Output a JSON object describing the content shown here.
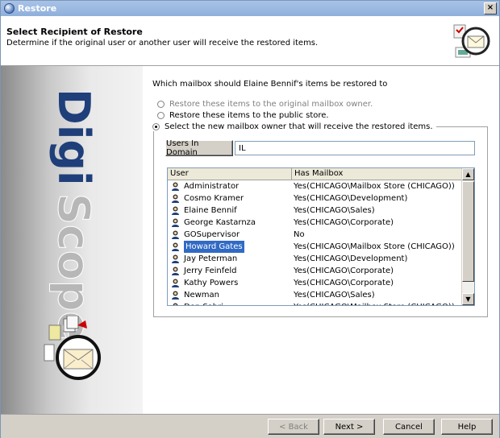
{
  "window": {
    "title": "Restore",
    "close_glyph": "×"
  },
  "header": {
    "title": "Select Recipient of Restore",
    "subtitle": "Determine if the original user or another user will receive the restored items."
  },
  "sidebar": {
    "brand_text": "DigiScope"
  },
  "content": {
    "question": "Which mailbox should Elaine Bennif's items be restored to",
    "options": [
      {
        "label": "Restore these items to the original mailbox owner.",
        "checked": false,
        "enabled": false
      },
      {
        "label": "Restore these items to the public store.",
        "checked": false,
        "enabled": true
      },
      {
        "label": "Select the new mailbox owner that will receive the restored items.",
        "checked": true,
        "enabled": true
      }
    ],
    "users_in_domain_button": "Users In Domain",
    "search_value": "IL",
    "columns": {
      "user": "User",
      "mailbox": "Has Mailbox"
    },
    "users": [
      {
        "name": "Administrator",
        "mailbox": "Yes(CHICAGO\\Mailbox Store (CHICAGO))"
      },
      {
        "name": "Cosmo Kramer",
        "mailbox": "Yes(CHICAGO\\Development)"
      },
      {
        "name": "Elaine Bennif",
        "mailbox": "Yes(CHICAGO\\Sales)"
      },
      {
        "name": "George Kastarnza",
        "mailbox": "Yes(CHICAGO\\Corporate)"
      },
      {
        "name": "GOSupervisor",
        "mailbox": "No"
      },
      {
        "name": "Howard Gates",
        "mailbox": "Yes(CHICAGO\\Mailbox Store (CHICAGO))",
        "selected": true
      },
      {
        "name": "Jay Peterman",
        "mailbox": "Yes(CHICAGO\\Development)"
      },
      {
        "name": "Jerry Feinfeld",
        "mailbox": "Yes(CHICAGO\\Corporate)"
      },
      {
        "name": "Kathy Powers",
        "mailbox": "Yes(CHICAGO\\Corporate)"
      },
      {
        "name": "Newman",
        "mailbox": "Yes(CHICAGO\\Sales)"
      },
      {
        "name": "Don Sabri",
        "mailbox": "Yes(CHICAGO\\Mailbox Store (CHICAGO))"
      }
    ]
  },
  "footer": {
    "back": "< Back",
    "next": "Next >",
    "cancel": "Cancel",
    "help": "Help"
  },
  "colors": {
    "selection": "#316ac5",
    "titlebar": "#8fb0dc",
    "dialog_face": "#d4d0c8"
  },
  "icons": [
    "restore-icon",
    "close-icon",
    "mail-clock-icon",
    "user-icon",
    "scroll-up-icon",
    "scroll-down-icon"
  ]
}
